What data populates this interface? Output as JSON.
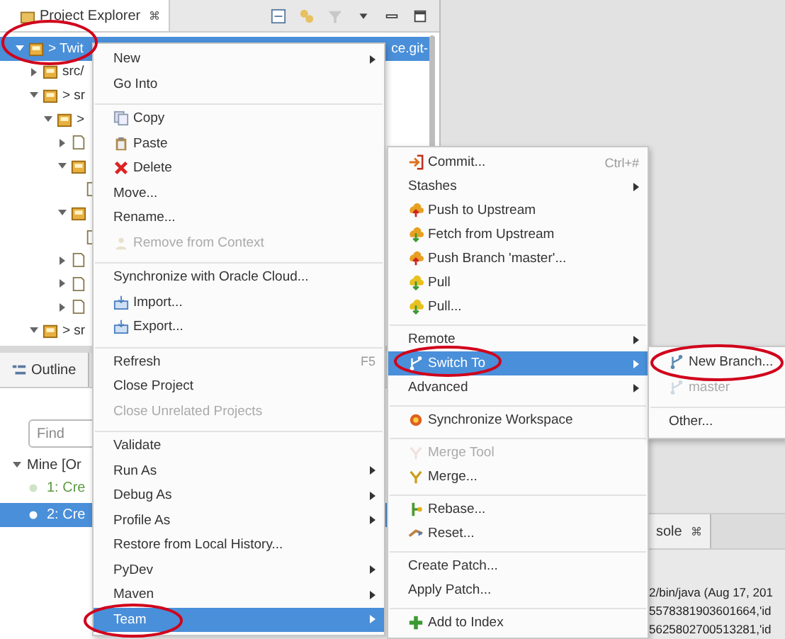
{
  "explorer": {
    "title": "Project Explorer",
    "close": "⌘",
    "tree": [
      {
        "label": "> Twit",
        "tail": "ce.git-",
        "expanded": true,
        "selected": true,
        "children": [
          {
            "label": "src/",
            "expanded": false,
            "selected": false
          },
          {
            "label": "> sr",
            "expanded": true,
            "selected": false,
            "children": [
              {
                "label": ">",
                "expanded": true,
                "selected": false,
                "children": [
                  {
                    "expanded": false,
                    "selected": false
                  },
                  {
                    "expanded": true,
                    "selected": false,
                    "children": [
                      {
                        "selected": false
                      }
                    ]
                  },
                  {
                    "expanded": true,
                    "selected": false,
                    "children": [
                      {
                        "selected": false
                      }
                    ]
                  },
                  {
                    "expanded": false,
                    "selected": false
                  },
                  {
                    "expanded": false,
                    "selected": false
                  },
                  {
                    "expanded": false,
                    "selected": false
                  }
                ]
              }
            ]
          },
          {
            "label": "> sr",
            "expanded": true,
            "selected": false
          }
        ]
      }
    ]
  },
  "outline": {
    "tabs": [
      {
        "label": "Outline",
        "selected": true
      }
    ],
    "search": {
      "placeholder": "Find"
    },
    "group": {
      "label": "Mine  [Or",
      "expanded": true
    },
    "tasks": [
      {
        "label": "1: Cre",
        "selected": false
      },
      {
        "label": "2: Cre",
        "selected": true
      }
    ]
  },
  "console": {
    "title": "sole",
    "close": "⌘",
    "lines": [
      "2/bin/java (Aug 17, 201",
      "5578381903601664,'id",
      "5625802700513281,'id"
    ]
  },
  "menus": [
    {
      "items": [
        {
          "kind": "item",
          "label": "New",
          "submenu": true,
          "disabled": false,
          "selected": false
        },
        {
          "kind": "item",
          "label": "Go Into",
          "submenu": false,
          "disabled": false,
          "selected": false
        },
        {
          "kind": "separator"
        },
        {
          "kind": "item",
          "label": "Copy",
          "submenu": false,
          "disabled": false,
          "selected": false
        },
        {
          "kind": "item",
          "label": "Paste",
          "submenu": false,
          "disabled": false,
          "selected": false
        },
        {
          "kind": "item",
          "label": "Delete",
          "submenu": false,
          "disabled": false,
          "selected": false
        },
        {
          "kind": "item",
          "label": "Move...",
          "submenu": false,
          "disabled": false,
          "selected": false
        },
        {
          "kind": "item",
          "label": "Rename...",
          "submenu": false,
          "disabled": false,
          "selected": false
        },
        {
          "kind": "item",
          "label": "Remove from Context",
          "submenu": false,
          "disabled": true,
          "selected": false
        },
        {
          "kind": "separator"
        },
        {
          "kind": "item",
          "label": "Synchronize with Oracle Cloud...",
          "submenu": false,
          "disabled": false,
          "selected": false
        },
        {
          "kind": "item",
          "label": "Import...",
          "submenu": false,
          "disabled": false,
          "selected": false
        },
        {
          "kind": "item",
          "label": "Export...",
          "submenu": false,
          "disabled": false,
          "selected": false
        },
        {
          "kind": "separator"
        },
        {
          "kind": "item",
          "label": "Refresh",
          "shortcut": "F5",
          "submenu": false,
          "disabled": false,
          "selected": false
        },
        {
          "kind": "item",
          "label": "Close Project",
          "submenu": false,
          "disabled": false,
          "selected": false
        },
        {
          "kind": "item",
          "label": "Close Unrelated Projects",
          "submenu": false,
          "disabled": true,
          "selected": false
        },
        {
          "kind": "separator"
        },
        {
          "kind": "item",
          "label": "Validate",
          "submenu": false,
          "disabled": false,
          "selected": false
        },
        {
          "kind": "item",
          "label": "Run As",
          "submenu": true,
          "disabled": false,
          "selected": false
        },
        {
          "kind": "item",
          "label": "Debug As",
          "submenu": true,
          "disabled": false,
          "selected": false
        },
        {
          "kind": "item",
          "label": "Profile As",
          "submenu": true,
          "disabled": false,
          "selected": false
        },
        {
          "kind": "item",
          "label": "Restore from Local History...",
          "submenu": false,
          "disabled": false,
          "selected": false
        },
        {
          "kind": "item",
          "label": "PyDev",
          "submenu": true,
          "disabled": false,
          "selected": false
        },
        {
          "kind": "item",
          "label": "Maven",
          "submenu": true,
          "disabled": false,
          "selected": false
        },
        {
          "kind": "item",
          "label": "Team",
          "submenu": true,
          "disabled": false,
          "selected": true
        }
      ]
    },
    {
      "items": [
        {
          "kind": "item",
          "label": "Commit...",
          "shortcut": "Ctrl+#",
          "submenu": false,
          "disabled": false,
          "selected": false
        },
        {
          "kind": "item",
          "label": "Stashes",
          "submenu": true,
          "disabled": false,
          "selected": false
        },
        {
          "kind": "item",
          "label": "Push to Upstream",
          "submenu": false,
          "disabled": false,
          "selected": false
        },
        {
          "kind": "item",
          "label": "Fetch from Upstream",
          "submenu": false,
          "disabled": false,
          "selected": false
        },
        {
          "kind": "item",
          "label": "Push Branch 'master'...",
          "submenu": false,
          "disabled": false,
          "selected": false
        },
        {
          "kind": "item",
          "label": "Pull",
          "submenu": false,
          "disabled": false,
          "selected": false
        },
        {
          "kind": "item",
          "label": "Pull...",
          "submenu": false,
          "disabled": false,
          "selected": false
        },
        {
          "kind": "separator"
        },
        {
          "kind": "item",
          "label": "Remote",
          "submenu": true,
          "disabled": false,
          "selected": false
        },
        {
          "kind": "item",
          "label": "Switch To",
          "submenu": true,
          "disabled": false,
          "selected": true
        },
        {
          "kind": "item",
          "label": "Advanced",
          "submenu": true,
          "disabled": false,
          "selected": false
        },
        {
          "kind": "separator"
        },
        {
          "kind": "item",
          "label": "Synchronize Workspace",
          "submenu": false,
          "disabled": false,
          "selected": false
        },
        {
          "kind": "separator"
        },
        {
          "kind": "item",
          "label": "Merge Tool",
          "submenu": false,
          "disabled": true,
          "selected": false
        },
        {
          "kind": "item",
          "label": "Merge...",
          "submenu": false,
          "disabled": false,
          "selected": false
        },
        {
          "kind": "separator"
        },
        {
          "kind": "item",
          "label": "Rebase...",
          "submenu": false,
          "disabled": false,
          "selected": false
        },
        {
          "kind": "item",
          "label": "Reset...",
          "submenu": false,
          "disabled": false,
          "selected": false
        },
        {
          "kind": "separator"
        },
        {
          "kind": "item",
          "label": "Create Patch...",
          "submenu": false,
          "disabled": false,
          "selected": false
        },
        {
          "kind": "item",
          "label": "Apply Patch...",
          "submenu": false,
          "disabled": false,
          "selected": false
        },
        {
          "kind": "separator"
        },
        {
          "kind": "item",
          "label": "Add to Index",
          "submenu": false,
          "disabled": false,
          "selected": false
        }
      ]
    },
    {
      "items": [
        {
          "kind": "item",
          "label": "New Branch...",
          "submenu": false,
          "disabled": false,
          "selected": false
        },
        {
          "kind": "item",
          "label": "master",
          "submenu": false,
          "disabled": true,
          "selected": false
        },
        {
          "kind": "separator"
        },
        {
          "kind": "item",
          "label": "Other...",
          "submenu": false,
          "disabled": false,
          "selected": false
        }
      ]
    }
  ]
}
